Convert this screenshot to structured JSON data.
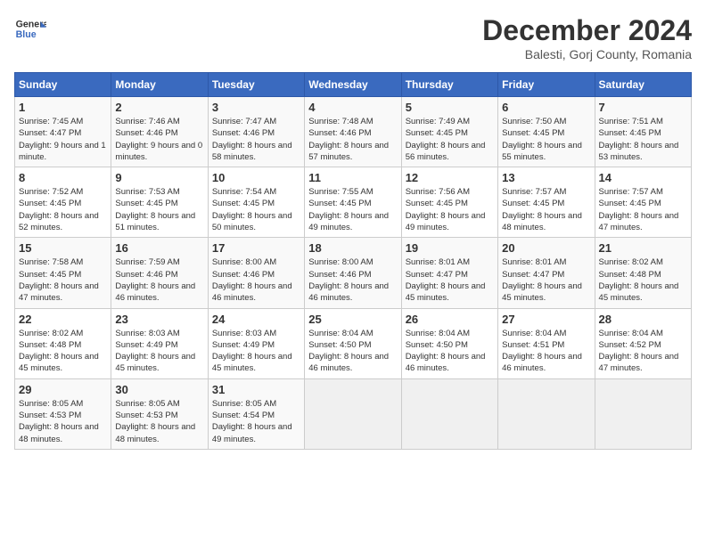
{
  "logo": {
    "line1": "General",
    "line2": "Blue"
  },
  "title": "December 2024",
  "subtitle": "Balesti, Gorj County, Romania",
  "days_of_week": [
    "Sunday",
    "Monday",
    "Tuesday",
    "Wednesday",
    "Thursday",
    "Friday",
    "Saturday"
  ],
  "weeks": [
    [
      {
        "day": "1",
        "sunrise": "7:45 AM",
        "sunset": "4:47 PM",
        "daylight": "9 hours and 1 minute."
      },
      {
        "day": "2",
        "sunrise": "7:46 AM",
        "sunset": "4:46 PM",
        "daylight": "9 hours and 0 minutes."
      },
      {
        "day": "3",
        "sunrise": "7:47 AM",
        "sunset": "4:46 PM",
        "daylight": "8 hours and 58 minutes."
      },
      {
        "day": "4",
        "sunrise": "7:48 AM",
        "sunset": "4:46 PM",
        "daylight": "8 hours and 57 minutes."
      },
      {
        "day": "5",
        "sunrise": "7:49 AM",
        "sunset": "4:45 PM",
        "daylight": "8 hours and 56 minutes."
      },
      {
        "day": "6",
        "sunrise": "7:50 AM",
        "sunset": "4:45 PM",
        "daylight": "8 hours and 55 minutes."
      },
      {
        "day": "7",
        "sunrise": "7:51 AM",
        "sunset": "4:45 PM",
        "daylight": "8 hours and 53 minutes."
      }
    ],
    [
      {
        "day": "8",
        "sunrise": "7:52 AM",
        "sunset": "4:45 PM",
        "daylight": "8 hours and 52 minutes."
      },
      {
        "day": "9",
        "sunrise": "7:53 AM",
        "sunset": "4:45 PM",
        "daylight": "8 hours and 51 minutes."
      },
      {
        "day": "10",
        "sunrise": "7:54 AM",
        "sunset": "4:45 PM",
        "daylight": "8 hours and 50 minutes."
      },
      {
        "day": "11",
        "sunrise": "7:55 AM",
        "sunset": "4:45 PM",
        "daylight": "8 hours and 49 minutes."
      },
      {
        "day": "12",
        "sunrise": "7:56 AM",
        "sunset": "4:45 PM",
        "daylight": "8 hours and 49 minutes."
      },
      {
        "day": "13",
        "sunrise": "7:57 AM",
        "sunset": "4:45 PM",
        "daylight": "8 hours and 48 minutes."
      },
      {
        "day": "14",
        "sunrise": "7:57 AM",
        "sunset": "4:45 PM",
        "daylight": "8 hours and 47 minutes."
      }
    ],
    [
      {
        "day": "15",
        "sunrise": "7:58 AM",
        "sunset": "4:45 PM",
        "daylight": "8 hours and 47 minutes."
      },
      {
        "day": "16",
        "sunrise": "7:59 AM",
        "sunset": "4:46 PM",
        "daylight": "8 hours and 46 minutes."
      },
      {
        "day": "17",
        "sunrise": "8:00 AM",
        "sunset": "4:46 PM",
        "daylight": "8 hours and 46 minutes."
      },
      {
        "day": "18",
        "sunrise": "8:00 AM",
        "sunset": "4:46 PM",
        "daylight": "8 hours and 46 minutes."
      },
      {
        "day": "19",
        "sunrise": "8:01 AM",
        "sunset": "4:47 PM",
        "daylight": "8 hours and 45 minutes."
      },
      {
        "day": "20",
        "sunrise": "8:01 AM",
        "sunset": "4:47 PM",
        "daylight": "8 hours and 45 minutes."
      },
      {
        "day": "21",
        "sunrise": "8:02 AM",
        "sunset": "4:48 PM",
        "daylight": "8 hours and 45 minutes."
      }
    ],
    [
      {
        "day": "22",
        "sunrise": "8:02 AM",
        "sunset": "4:48 PM",
        "daylight": "8 hours and 45 minutes."
      },
      {
        "day": "23",
        "sunrise": "8:03 AM",
        "sunset": "4:49 PM",
        "daylight": "8 hours and 45 minutes."
      },
      {
        "day": "24",
        "sunrise": "8:03 AM",
        "sunset": "4:49 PM",
        "daylight": "8 hours and 45 minutes."
      },
      {
        "day": "25",
        "sunrise": "8:04 AM",
        "sunset": "4:50 PM",
        "daylight": "8 hours and 46 minutes."
      },
      {
        "day": "26",
        "sunrise": "8:04 AM",
        "sunset": "4:50 PM",
        "daylight": "8 hours and 46 minutes."
      },
      {
        "day": "27",
        "sunrise": "8:04 AM",
        "sunset": "4:51 PM",
        "daylight": "8 hours and 46 minutes."
      },
      {
        "day": "28",
        "sunrise": "8:04 AM",
        "sunset": "4:52 PM",
        "daylight": "8 hours and 47 minutes."
      }
    ],
    [
      {
        "day": "29",
        "sunrise": "8:05 AM",
        "sunset": "4:53 PM",
        "daylight": "8 hours and 48 minutes."
      },
      {
        "day": "30",
        "sunrise": "8:05 AM",
        "sunset": "4:53 PM",
        "daylight": "8 hours and 48 minutes."
      },
      {
        "day": "31",
        "sunrise": "8:05 AM",
        "sunset": "4:54 PM",
        "daylight": "8 hours and 49 minutes."
      },
      null,
      null,
      null,
      null
    ]
  ],
  "labels": {
    "sunrise": "Sunrise: ",
    "sunset": "Sunset: ",
    "daylight": "Daylight: "
  }
}
